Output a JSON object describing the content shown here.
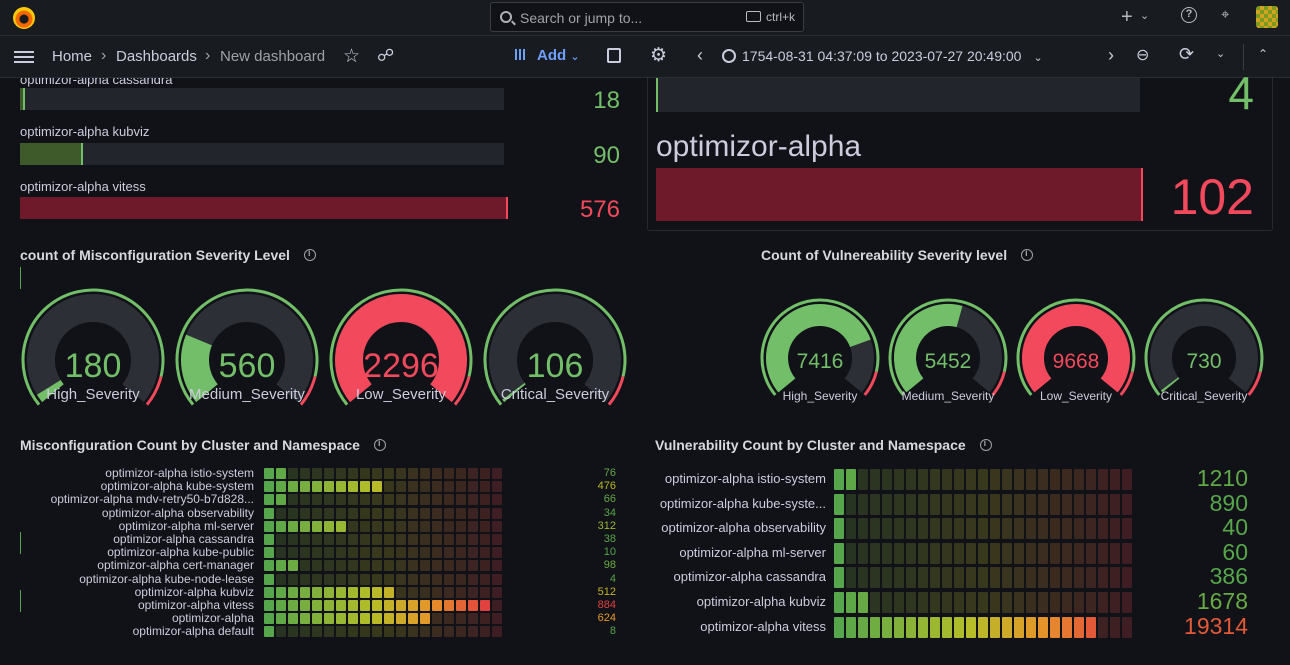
{
  "topbar": {
    "search_placeholder": "Search or jump to...",
    "search_shortcut": "ctrl+k",
    "icons": [
      "grafana-logo-icon",
      "plus-icon",
      "chevron-down-icon",
      "help-icon",
      "rss-icon",
      "avatar"
    ]
  },
  "navbar": {
    "breadcrumb": [
      "Home",
      "Dashboards",
      "New dashboard"
    ],
    "add_label": "Add",
    "time_range": "1754-08-31 04:37:09 to 2023-07-27 20:49:00",
    "colors": {
      "accent": "#6e9fff"
    }
  },
  "bargauge_left": {
    "rows": [
      {
        "label": "optimizor-alpha cassandra",
        "value": "18",
        "fraction": 0.01,
        "color": "#73bf69"
      },
      {
        "label": "optimizor-alpha kubviz",
        "value": "90",
        "fraction": 0.13,
        "color": "#73bf69"
      },
      {
        "label": "optimizor-alpha vitess",
        "value": "576",
        "fraction": 1.0,
        "color": "#f2495c"
      }
    ]
  },
  "bargauge_right": {
    "rows": [
      {
        "label": "",
        "value": "4",
        "fraction": 0.0,
        "color": "#73bf69"
      },
      {
        "label": "optimizor-alpha",
        "value": "102",
        "fraction": 1.0,
        "color": "#f2495c"
      }
    ]
  },
  "misconfig_gauges": {
    "title": "count of Misconfiguration Severity Level",
    "items": [
      {
        "value": "180",
        "label": "High_Severity",
        "fraction": 0.03,
        "color": "#73bf69"
      },
      {
        "value": "560",
        "label": "Medium_Severity",
        "fraction": 0.24,
        "color": "#73bf69"
      },
      {
        "value": "2296",
        "label": "Low_Severity",
        "fraction": 1.0,
        "color": "#f2495c"
      },
      {
        "value": "106",
        "label": "Critical_Severity",
        "fraction": 0.0,
        "color": "#73bf69"
      }
    ]
  },
  "vuln_gauges": {
    "title": "Count of Vulnereability Severity level",
    "items": [
      {
        "value": "7416",
        "label": "High_Severity",
        "fraction": 0.77,
        "color": "#73bf69"
      },
      {
        "value": "5452",
        "label": "Medium_Severity",
        "fraction": 0.56,
        "color": "#73bf69"
      },
      {
        "value": "9668",
        "label": "Low_Severity",
        "fraction": 1.0,
        "color": "#f2495c"
      },
      {
        "value": "730",
        "label": "Critical_Severity",
        "fraction": 0.0,
        "color": "#73bf69"
      }
    ]
  },
  "misconfig_heat": {
    "title": "Misconfiguration Count by Cluster and Namespace",
    "rows": [
      {
        "label": "optimizor-alpha istio-system",
        "value": "76",
        "lit": 2
      },
      {
        "label": "optimizor-alpha kube-system",
        "value": "476",
        "lit": 10
      },
      {
        "label": "optimizor-alpha mdv-retry50-b7d828...",
        "value": "66",
        "lit": 2
      },
      {
        "label": "optimizor-alpha observability",
        "value": "34",
        "lit": 1
      },
      {
        "label": "optimizor-alpha ml-server",
        "value": "312",
        "lit": 7
      },
      {
        "label": "optimizor-alpha cassandra",
        "value": "38",
        "lit": 1
      },
      {
        "label": "optimizor-alpha kube-public",
        "value": "10",
        "lit": 1
      },
      {
        "label": "optimizor-alpha cert-manager",
        "value": "98",
        "lit": 3
      },
      {
        "label": "optimizor-alpha kube-node-lease",
        "value": "4",
        "lit": 1
      },
      {
        "label": "optimizor-alpha kubviz",
        "value": "512",
        "lit": 11
      },
      {
        "label": "optimizor-alpha vitess",
        "value": "884",
        "lit": 19
      },
      {
        "label": "optimizor-alpha",
        "value": "624",
        "lit": 14
      },
      {
        "label": "optimizor-alpha default",
        "value": "8",
        "lit": 1
      }
    ]
  },
  "vuln_heat": {
    "title": "Vulnerability Count by Cluster and Namespace",
    "rows": [
      {
        "label": "optimizor-alpha istio-system",
        "value": "1210",
        "lit": 2
      },
      {
        "label": "optimizor-alpha kube-syste...",
        "value": "890",
        "lit": 1
      },
      {
        "label": "optimizor-alpha observability",
        "value": "40",
        "lit": 1
      },
      {
        "label": "optimizor-alpha ml-server",
        "value": "60",
        "lit": 1
      },
      {
        "label": "optimizor-alpha cassandra",
        "value": "386",
        "lit": 1
      },
      {
        "label": "optimizor-alpha kubviz",
        "value": "1678",
        "lit": 3
      },
      {
        "label": "optimizor-alpha vitess",
        "value": "19314",
        "lit": 22
      }
    ]
  }
}
